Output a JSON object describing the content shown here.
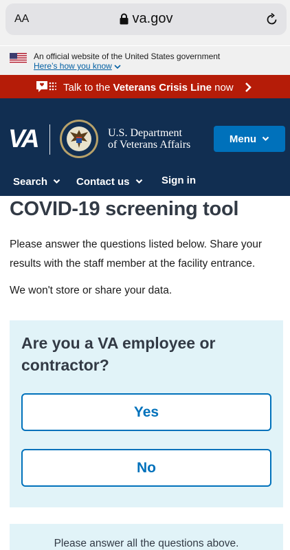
{
  "browser": {
    "text_size_label": "AA",
    "url": "va.gov"
  },
  "official_banner": {
    "text": "An official website of the United States government",
    "link": "Here’s how you know"
  },
  "crisis_line": {
    "prefix": "Talk to the ",
    "bold": "Veterans Crisis Line",
    "suffix": " now"
  },
  "header": {
    "logo": "VA",
    "dept_line1": "U.S. Department",
    "dept_line2": "of Veterans Affairs",
    "menu_label": "Menu",
    "nav": [
      {
        "label": "Search"
      },
      {
        "label": "Contact us"
      },
      {
        "label": "Sign in"
      }
    ]
  },
  "main": {
    "title": "COVID-19 screening tool",
    "intro": "Please answer the questions listed below. Share your results with the staff member at the facility entrance.",
    "privacy": "We won't store or share your data.",
    "question": "Are you a VA employee or contractor?",
    "answers": [
      "Yes",
      "No"
    ],
    "footer_note": "Please answer all the questions above."
  },
  "colors": {
    "crisis_red": "#b51c08",
    "header_navy": "#112e51",
    "primary_blue": "#0071bb",
    "question_bg": "#e1f3f8"
  }
}
